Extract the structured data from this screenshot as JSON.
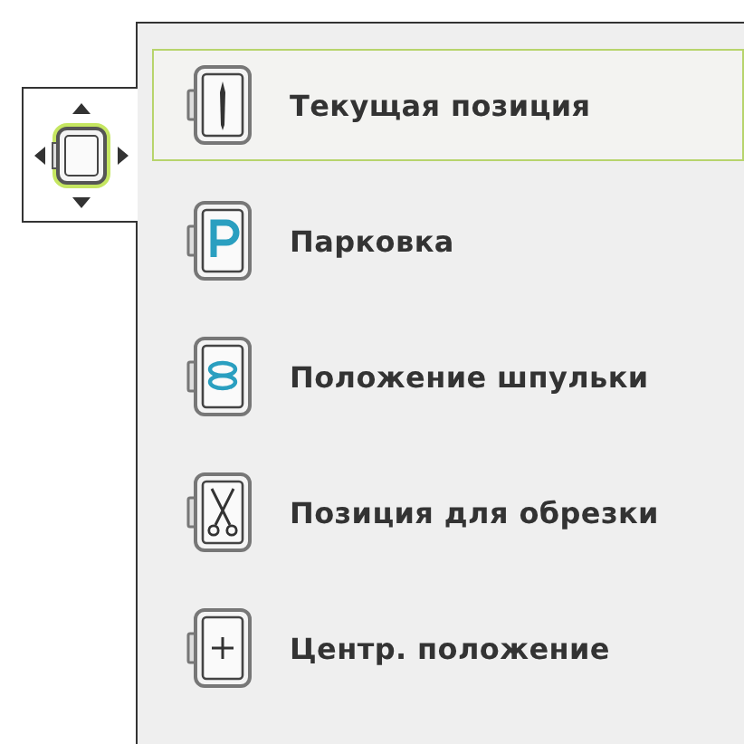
{
  "trigger": {
    "kind": "move-frame",
    "selected": true
  },
  "menu": {
    "items": [
      {
        "label": "Текущая позиция",
        "kind": "needle",
        "selected": true
      },
      {
        "label": "Парковка",
        "kind": "parking",
        "selected": false
      },
      {
        "label": "Положение шпульки",
        "kind": "bobbin",
        "selected": false
      },
      {
        "label": "Позиция для обрезки",
        "kind": "scissors",
        "selected": false
      },
      {
        "label": "Центр. положение",
        "kind": "center",
        "selected": false
      }
    ]
  }
}
